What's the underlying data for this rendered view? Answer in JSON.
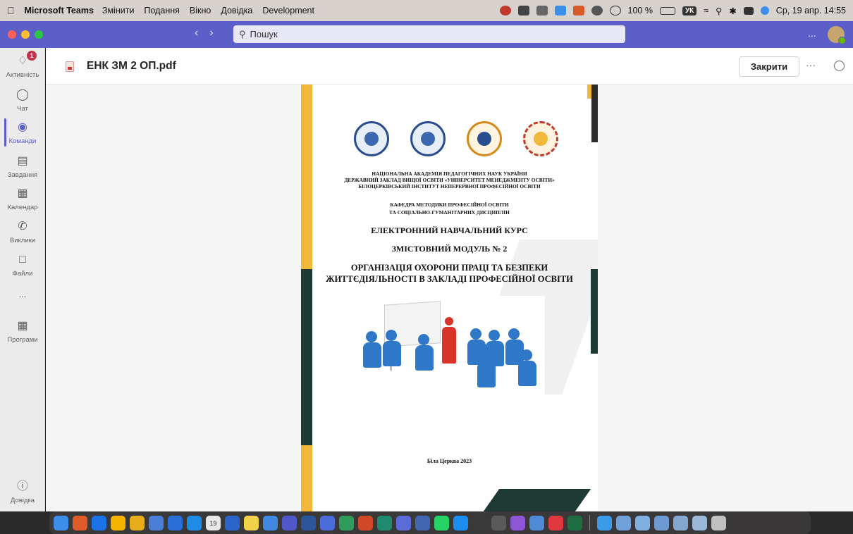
{
  "menubar": {
    "app_name": "Microsoft Teams",
    "items": [
      "Змінити",
      "Подання",
      "Вікно",
      "Довідка",
      "Development"
    ],
    "battery": "100 %",
    "lang_badge": "УК",
    "datetime": "Ср, 19 апр.  14:55"
  },
  "titlebar": {
    "search_placeholder": "Пошук",
    "more": "..."
  },
  "rail": {
    "items": [
      {
        "label": "Активність",
        "icon": "bell-icon",
        "badge": "1"
      },
      {
        "label": "Чат",
        "icon": "chat-icon"
      },
      {
        "label": "Команди",
        "icon": "teams-icon"
      },
      {
        "label": "Завдання",
        "icon": "assignments-icon"
      },
      {
        "label": "Календар",
        "icon": "calendar-icon"
      },
      {
        "label": "Виклики",
        "icon": "phone-icon"
      },
      {
        "label": "Файли",
        "icon": "file-icon"
      },
      {
        "label": "...",
        "icon": "more-icon"
      },
      {
        "label": "Програми",
        "icon": "apps-icon"
      }
    ],
    "help_label": "Довідка"
  },
  "header": {
    "file_name": "ЕНК ЗМ 2 ОП.pdf",
    "close_label": "Закрити",
    "more": "···"
  },
  "document": {
    "org_lines": [
      "НАЦІОНАЛЬНА АКАДЕМІЯ ПЕДАГОГІЧНИХ НАУК УКРАЇНИ",
      "ДЕРЖАВНИЙ ЗАКЛАД ВИЩОЇ ОСВІТИ «УНІВЕРСИТЕТ МЕНЕДЖМЕНТУ ОСВІТИ»",
      "БІЛОЦЕРКІВСЬКИЙ ІНСТИТУТ  НЕПЕРЕРВНОЇ ПРОФЕСІЙНОЇ ОСВІТИ"
    ],
    "dept_lines": [
      "КАФЕДРА МЕТОДИКИ ПРОФЕСІЙНОЇ ОСВІТИ",
      "ТА СОЦІАЛЬНО-ГУМАНІТАРНИХ ДИСЦИПЛІН"
    ],
    "course": "ЕЛЕКТРОННИЙ НАВЧАЛЬНИЙ КУРС",
    "module": "ЗМІСТОВНИЙ МОДУЛЬ № 2",
    "title_lines": [
      "ОРГАНІЗАЦІЯ ОХОРОНИ ПРАЦІ ТА БЕЗПЕКИ",
      "ЖИТТЄДІЯЛЬНОСТІ В ЗАКЛАДІ ПРОФЕСІЙНОЇ ОСВІТИ"
    ],
    "city_year": "Біла Церква 2023"
  },
  "dock": {
    "calendar_day": "19",
    "app_colors": [
      "#3b8eea",
      "#e05b2a",
      "#1a73e8",
      "#f4b400",
      "#e6ac1a",
      "#4a7fd6",
      "#2a6fd8",
      "#1e8ce6",
      "#e8e8e8",
      "#2b65c9",
      "#f3d24b",
      "#3f8ae0",
      "#5059c9",
      "#2b579a",
      "#4a6cd8",
      "#2e9c5a",
      "#d24726",
      "#1f8a70",
      "#5b6bd8",
      "#4267b2",
      "#25d366",
      "#1c8ef2",
      "#3a3a3a",
      "#5a5a5a",
      "#8c56d6",
      "#4f8ad6",
      "#e0383e",
      "#1d6f42",
      "#3a9be8",
      "#6fa0d8",
      "#7eb0e0",
      "#6d9ad0",
      "#83a7d0",
      "#9ab8d8",
      "#c0c0c0"
    ]
  }
}
